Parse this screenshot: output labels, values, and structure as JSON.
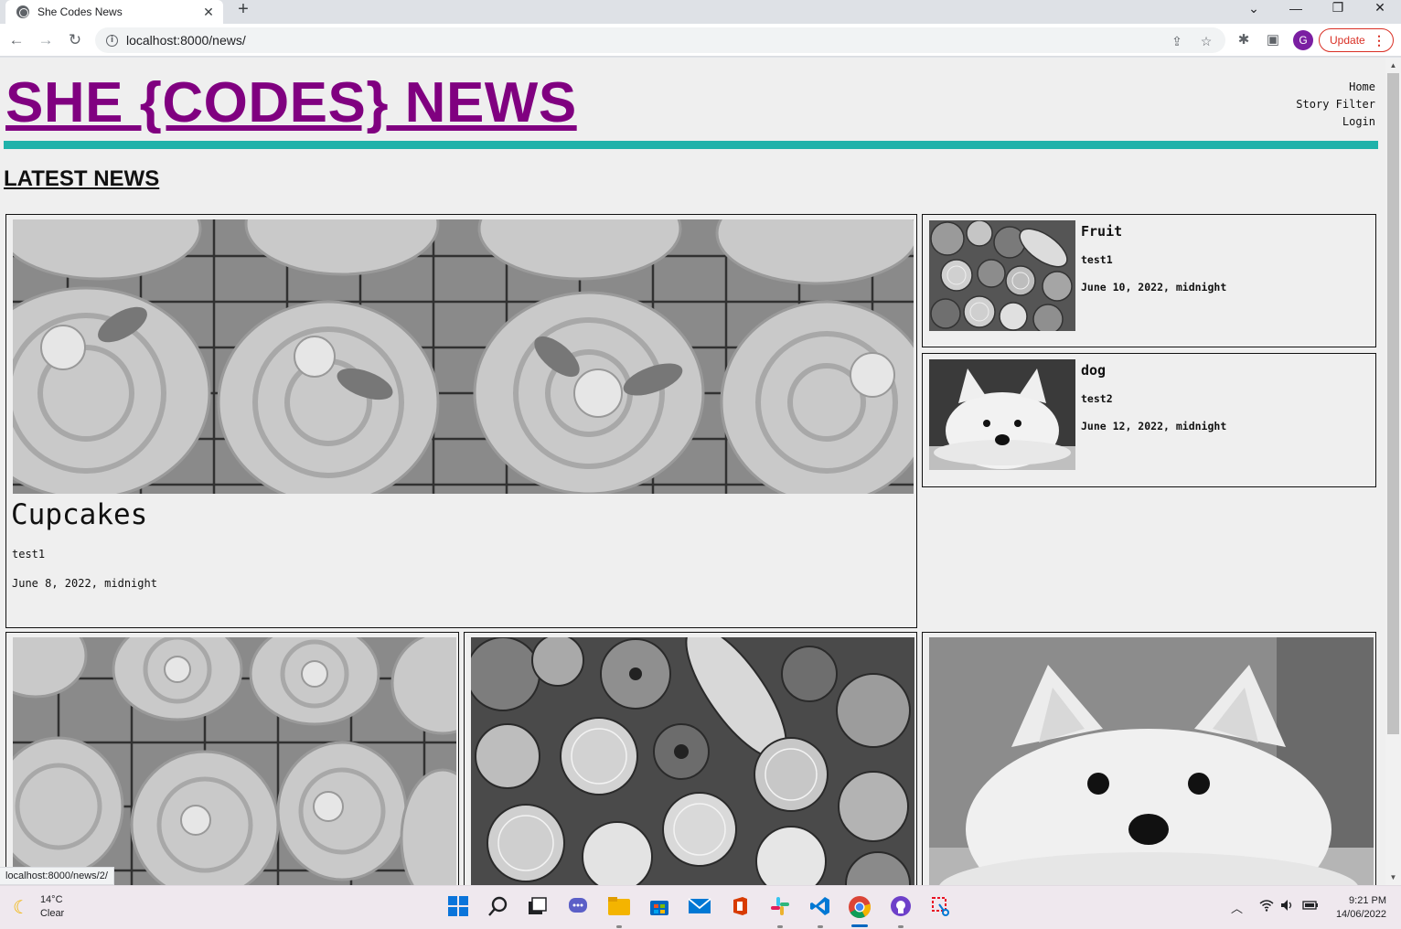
{
  "browser": {
    "tab_title": "She Codes News",
    "url": "localhost:8000/news/",
    "update_label": "Update",
    "profile_initial": "G",
    "status_url": "localhost:8000/news/2/"
  },
  "site": {
    "title": "SHE {CODES} NEWS",
    "nav": [
      "Home",
      "Story Filter",
      "Login"
    ],
    "section_title": "LATEST NEWS",
    "accent_color": "#20b2aa",
    "title_color": "#800080"
  },
  "featured": {
    "title": "Cupcakes",
    "author": "test1",
    "date": "June 8, 2022, midnight",
    "image": "cupcakes-photo"
  },
  "side_stories": [
    {
      "title": "Fruit",
      "author": "test1",
      "date": "June 10, 2022, midnight",
      "image": "fruit-photo"
    },
    {
      "title": "dog",
      "author": "test2",
      "date": "June 12, 2022, midnight",
      "image": "dog-photo"
    }
  ],
  "grid_stories": [
    {
      "image": "cupcakes-photo"
    },
    {
      "image": "fruit-photo"
    },
    {
      "image": "dog-photo"
    }
  ],
  "taskbar": {
    "temperature": "14°C",
    "condition": "Clear",
    "time": "9:21 PM",
    "date": "14/06/2022"
  }
}
